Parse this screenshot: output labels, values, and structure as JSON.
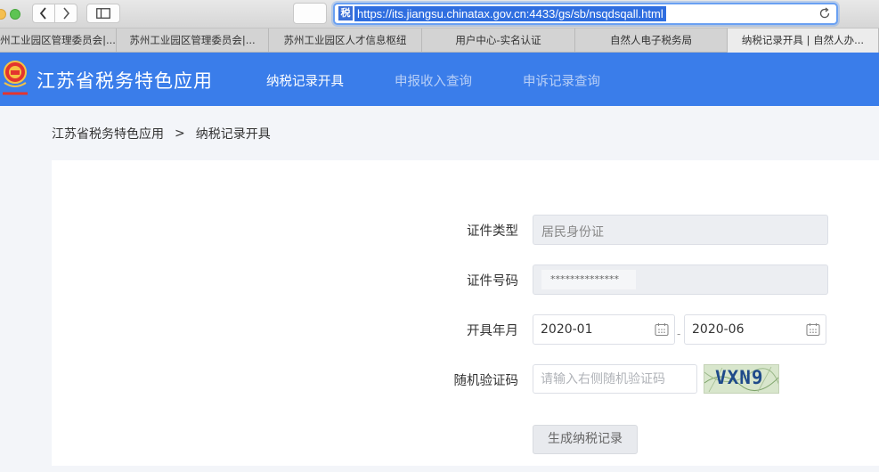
{
  "browser": {
    "url": "https://its.jiangsu.chinatax.gov.cn:4433/gs/sb/nsqdsqall.html",
    "favicon_text": "税",
    "tabs": [
      {
        "label": "州工业园区管理委员会|..."
      },
      {
        "label": "苏州工业园区管理委员会|..."
      },
      {
        "label": "苏州工业园区人才信息枢纽"
      },
      {
        "label": "用户中心-实名认证"
      },
      {
        "label": "自然人电子税务局"
      },
      {
        "label": "纳税记录开具 | 自然人办..."
      }
    ]
  },
  "header": {
    "site_title": "江苏省税务特色应用",
    "nav": [
      {
        "label": "纳税记录开具"
      },
      {
        "label": "申报收入查询"
      },
      {
        "label": "申诉记录查询"
      }
    ]
  },
  "breadcrumb": {
    "root": "江苏省税务特色应用",
    "separator": ">",
    "current": "纳税记录开具"
  },
  "form": {
    "id_type_label": "证件类型",
    "id_type_value": "居民身份证",
    "id_number_label": "证件号码",
    "id_number_value": "**************",
    "period_label": "开具年月",
    "period_start": "2020-01",
    "period_separator": "-",
    "period_end": "2020-06",
    "captcha_label": "随机验证码",
    "captcha_placeholder": "请输入右侧随机验证码",
    "captcha_image_text": "VXN9",
    "submit_label": "生成纳税记录"
  }
}
